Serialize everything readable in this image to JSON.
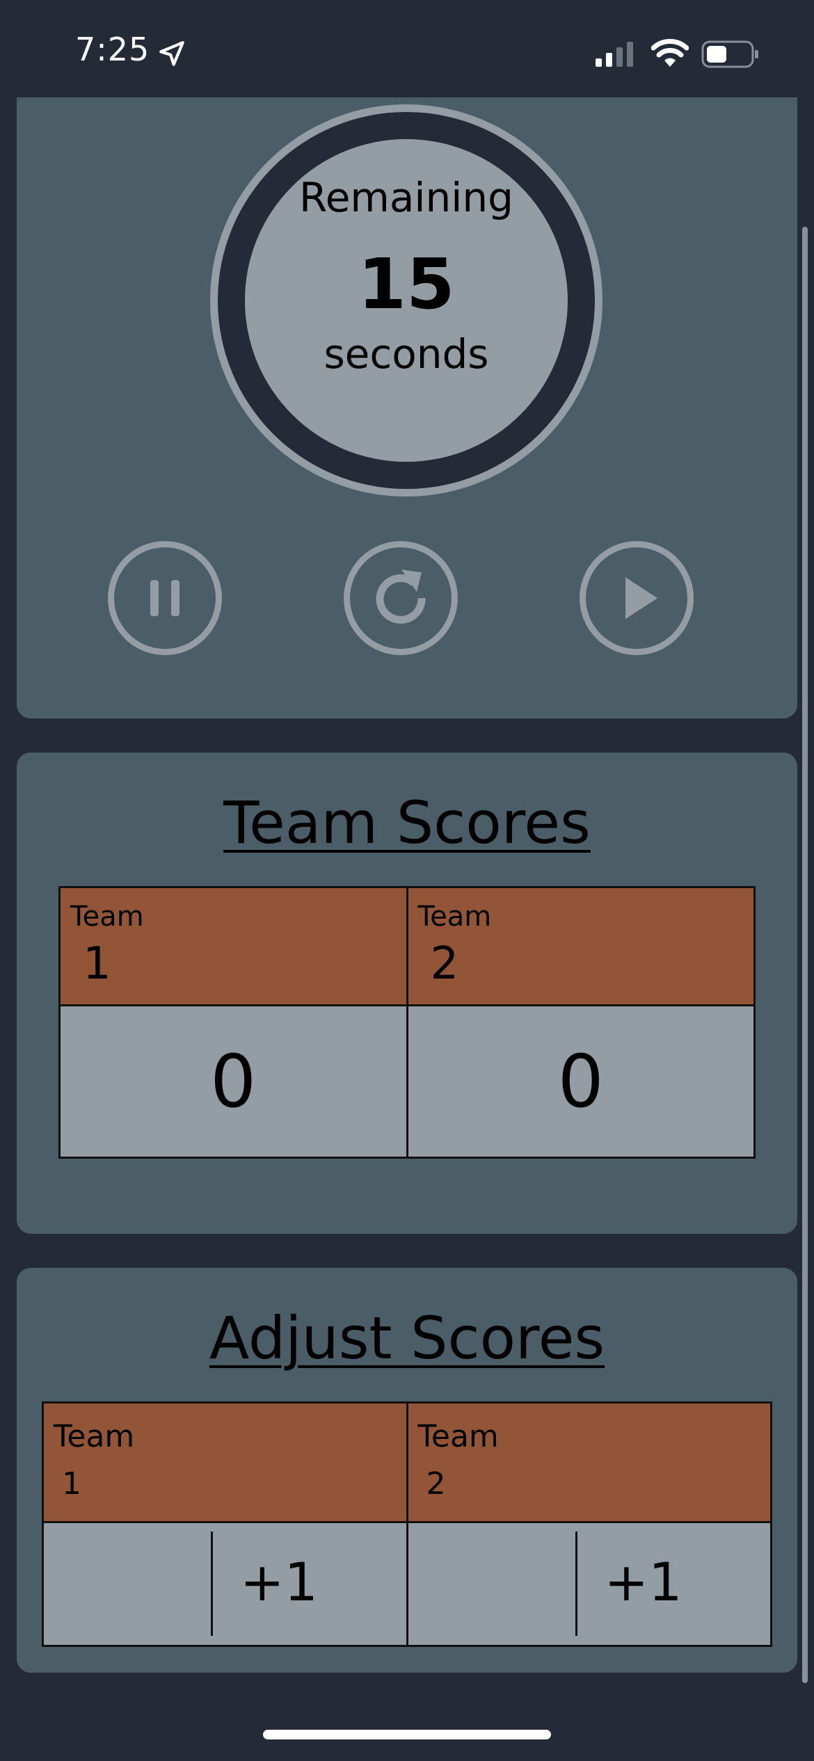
{
  "status_bar": {
    "time": "7:25",
    "icons": [
      "location-arrow-icon",
      "cellular-signal-icon",
      "wifi-icon",
      "battery-icon"
    ]
  },
  "timer": {
    "label_top": "Remaining",
    "value": "15",
    "label_bottom": "seconds",
    "controls": [
      "pause-icon",
      "restart-icon",
      "play-icon"
    ]
  },
  "team_scores": {
    "title": "Team Scores",
    "teams": [
      {
        "word": "Team",
        "number": "1",
        "score": "0"
      },
      {
        "word": "Team",
        "number": "2",
        "score": "0"
      }
    ]
  },
  "adjust_scores": {
    "title": "Adjust Scores",
    "teams": [
      {
        "word": "Team",
        "number": "1",
        "increment_label": "+1"
      },
      {
        "word": "Team",
        "number": "2",
        "increment_label": "+1"
      }
    ]
  },
  "colors": {
    "background": "#242b37",
    "card": "#4b5e68",
    "team_header": "#925537",
    "cell": "#949ca4"
  }
}
